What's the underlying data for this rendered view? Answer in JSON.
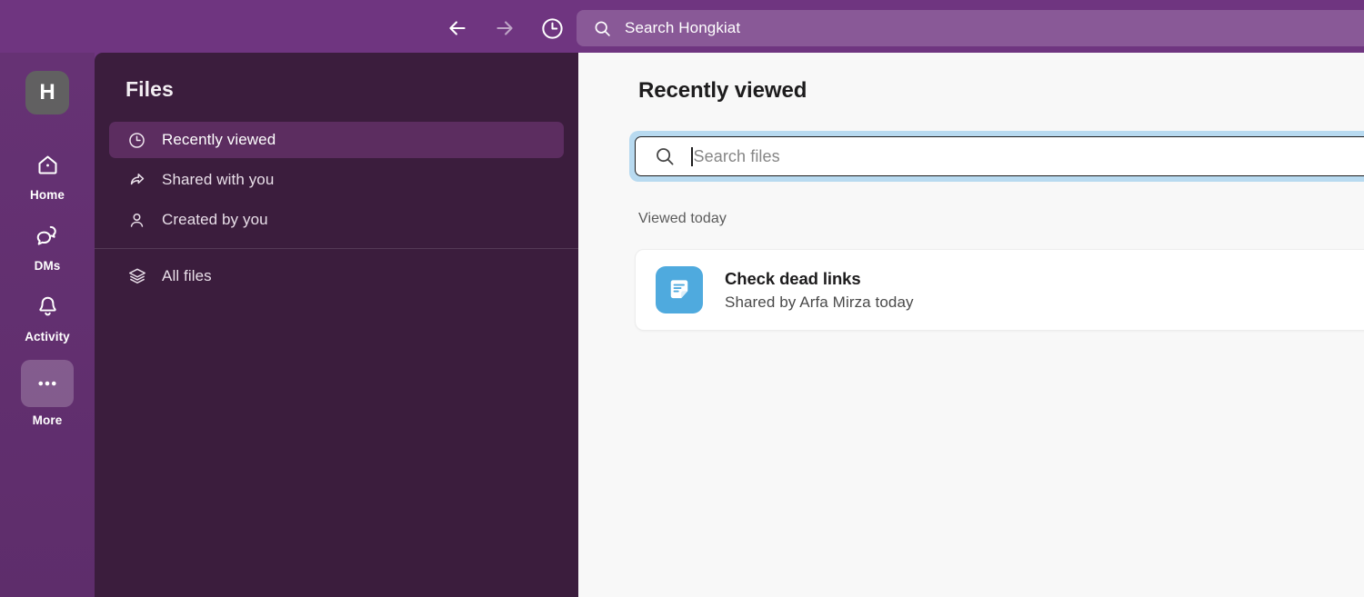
{
  "topbar": {
    "back_icon": "arrow-left-icon",
    "forward_icon": "arrow-right-icon",
    "history_icon": "clock-icon",
    "search": {
      "icon": "search-icon",
      "label": "Search Hongkiat"
    }
  },
  "rail": {
    "avatar_letter": "H",
    "items": [
      {
        "label": "Home",
        "icon": "home-icon",
        "active": false
      },
      {
        "label": "DMs",
        "icon": "dms-icon",
        "active": false
      },
      {
        "label": "Activity",
        "icon": "bell-icon",
        "active": false
      },
      {
        "label": "More",
        "icon": "ellipsis-icon",
        "active": true
      }
    ]
  },
  "sidebar": {
    "title": "Files",
    "items": [
      {
        "label": "Recently viewed",
        "icon": "clock-icon",
        "selected": true
      },
      {
        "label": "Shared with you",
        "icon": "share-arrow-icon",
        "selected": false
      },
      {
        "label": "Created by you",
        "icon": "person-icon",
        "selected": false
      }
    ],
    "lower_items": [
      {
        "label": "All files",
        "icon": "layers-icon",
        "selected": false
      }
    ]
  },
  "main": {
    "title": "Recently viewed",
    "search": {
      "icon": "search-icon",
      "value": "",
      "placeholder": "Search files"
    },
    "section_label": "Viewed today",
    "files": [
      {
        "name": "Check dead links",
        "subtitle": "Shared by Arfa Mirza today",
        "icon": "canvas-post-icon",
        "icon_color": "#4FAADE"
      }
    ]
  },
  "colors": {
    "header_purple": "#6F3580",
    "rail_purple": "#5E2F69",
    "panel_purple": "#3B1D3D",
    "selected_purple": "#5C2D60",
    "main_bg": "#F8F8F8",
    "focus_ring": "#B8DAF0",
    "file_icon_blue": "#4FAADE"
  }
}
